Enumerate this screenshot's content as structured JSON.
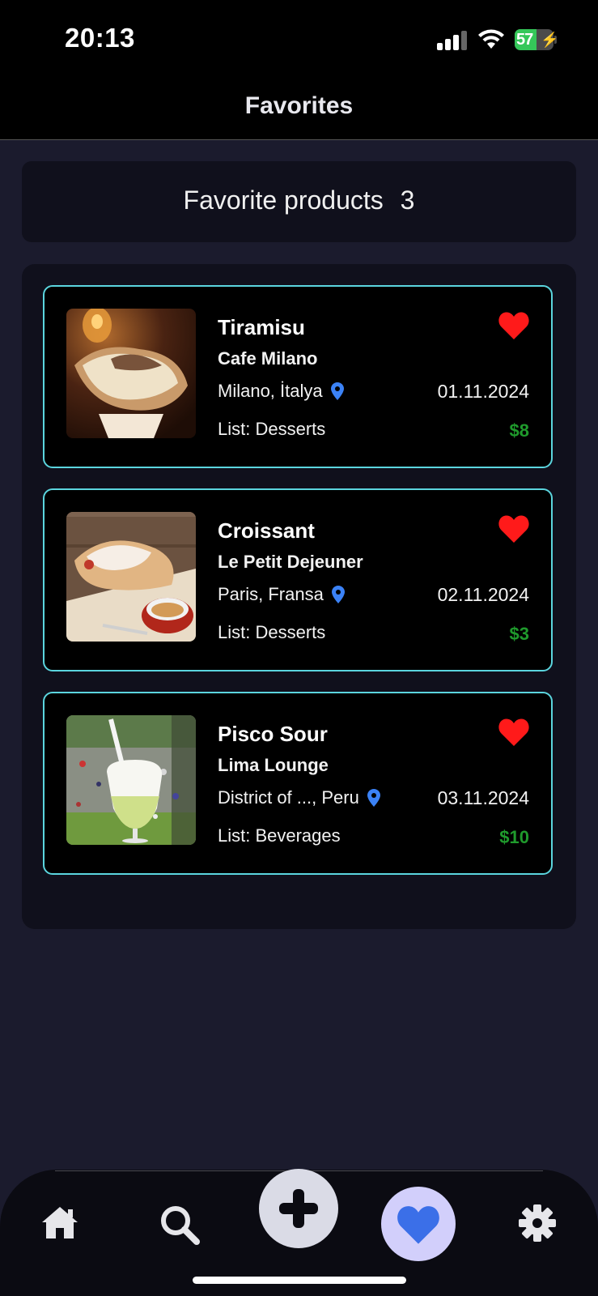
{
  "status_bar": {
    "time": "20:13",
    "battery_percent": "57",
    "battery_level": 0.57
  },
  "header": {
    "title": "Favorites"
  },
  "summary": {
    "label": "Favorite products",
    "count": "3"
  },
  "products": [
    {
      "name": "Tiramisu",
      "venue": "Cafe Milano",
      "location": "Milano, İtalya",
      "date": "01.11.2024",
      "list": "List: Desserts",
      "price": "$8",
      "favorited": true
    },
    {
      "name": "Croissant",
      "venue": "Le Petit Dejeuner",
      "location": "Paris, Fransa",
      "date": "02.11.2024",
      "list": "List: Desserts",
      "price": "$3",
      "favorited": true
    },
    {
      "name": "Pisco Sour",
      "venue": "Lima Lounge",
      "location": "District of ..., Peru",
      "date": "03.11.2024",
      "list": "List: Beverages",
      "price": "$10",
      "favorited": true
    }
  ],
  "tab_bar": {
    "tabs": [
      {
        "icon": "home-icon",
        "active": false
      },
      {
        "icon": "search-icon",
        "active": false
      },
      {
        "icon": "plus-icon",
        "active": false
      },
      {
        "icon": "heart-icon",
        "active": true
      },
      {
        "icon": "gear-icon",
        "active": false
      }
    ]
  },
  "colors": {
    "background": "#1b1b2d",
    "panel": "#10101c",
    "card_border": "#5bd5de",
    "favorite_heart": "#ff1a1a",
    "price": "#1f9a2c",
    "pin": "#3b82f6",
    "active_tab_bg": "#d2cffb",
    "active_tab_icon": "#3b6fe8"
  }
}
